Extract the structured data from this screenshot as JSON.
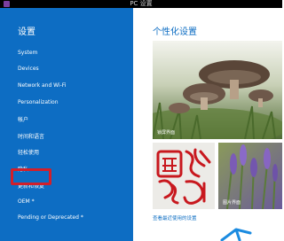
{
  "window": {
    "title": "PC 设置"
  },
  "sidebar": {
    "title": "设置",
    "items": [
      {
        "label": "System"
      },
      {
        "label": "Devices"
      },
      {
        "label": "Network and Wi-Fi"
      },
      {
        "label": "Personalization"
      },
      {
        "label": "帐户"
      },
      {
        "label": "时间和语言"
      },
      {
        "label": "轻松使用"
      },
      {
        "label": "隐私"
      },
      {
        "label": "更新和恢复"
      },
      {
        "label": "OEM *"
      },
      {
        "label": "Pending or Deprecated *"
      }
    ]
  },
  "main": {
    "title": "个性化设置",
    "tiles": [
      {
        "caption": "锁屏界面",
        "icon": "mushroom-photo"
      },
      {
        "caption": "",
        "icon": "chinese-seal-photo"
      },
      {
        "caption": "图片界面",
        "icon": "lavender-photo"
      }
    ],
    "link": "查看最近使用的设置"
  },
  "colors": {
    "sidebar": "#0d6dc3",
    "accent": "#0d6dc3",
    "highlight": "#d21f2a",
    "titlebar": "#000000"
  }
}
